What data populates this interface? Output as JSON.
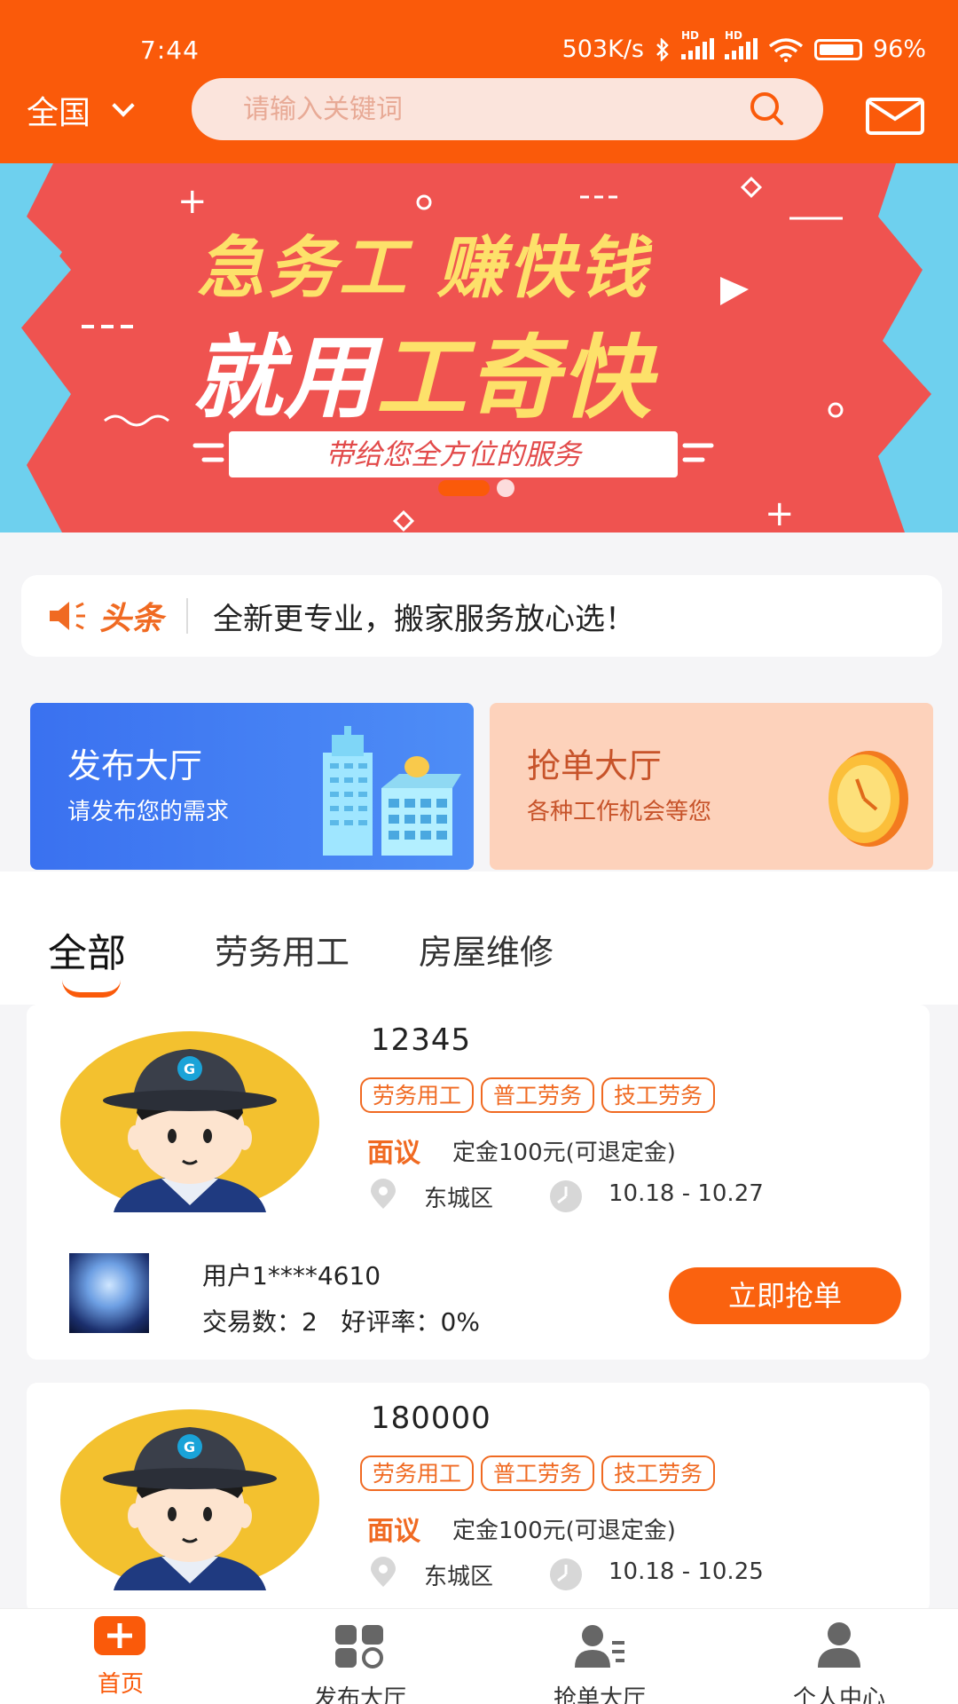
{
  "status_bar": {
    "time": "7:44",
    "network_speed": "503K/s",
    "signal1_label": "HD",
    "signal2_label": "HD",
    "battery": "96%"
  },
  "header": {
    "region": "全国",
    "search_placeholder": "请输入关键词"
  },
  "banner": {
    "line1": "急务工 赚快钱",
    "line2_white": "就用",
    "line2_yellow": "工奇快",
    "pill_text": "带给您全方位的服务",
    "page_count": 2,
    "current_page": 1
  },
  "news": {
    "brand": "头条",
    "text": "全新更专业，搬家服务放心选！"
  },
  "entries": {
    "publish": {
      "title": "发布大厅",
      "subtitle": "请发布您的需求"
    },
    "grab": {
      "title": "抢单大厅",
      "subtitle": "各种工作机会等您"
    }
  },
  "tabs": [
    {
      "label": "全部",
      "active": true
    },
    {
      "label": "劳务用工",
      "active": false
    },
    {
      "label": "房屋维修",
      "active": false
    }
  ],
  "jobs": [
    {
      "title": "12345",
      "tags": [
        "劳务用工",
        "普工劳务",
        "技工劳务"
      ],
      "price": "面议",
      "deposit": "定金100元(可退定金)",
      "location": "东城区",
      "date_range": "10.18 - 10.27",
      "user": "用户1****4610",
      "stats": "交易数：2   好评率：0%",
      "button": "立即抢单"
    },
    {
      "title": "180000",
      "tags": [
        "劳务用工",
        "普工劳务",
        "技工劳务"
      ],
      "price": "面议",
      "deposit": "定金100元(可退定金)",
      "location": "东城区",
      "date_range": "10.18 - 10.25"
    }
  ],
  "nav": [
    {
      "label": "首页",
      "icon": "home-plus-icon",
      "active": true
    },
    {
      "label": "发布大厅",
      "icon": "grid-icon",
      "active": false
    },
    {
      "label": "抢单大厅",
      "icon": "user-list-icon",
      "active": false
    },
    {
      "label": "个人中心",
      "icon": "person-icon",
      "active": false
    }
  ],
  "colors": {
    "accent": "#fa5a0a",
    "banner_red": "#ef5350",
    "banner_blue": "#6ed0ee",
    "banner_yellow": "#fde16a",
    "publish_blue": "#3a71f0",
    "grab_peach": "#fdd2bb"
  }
}
